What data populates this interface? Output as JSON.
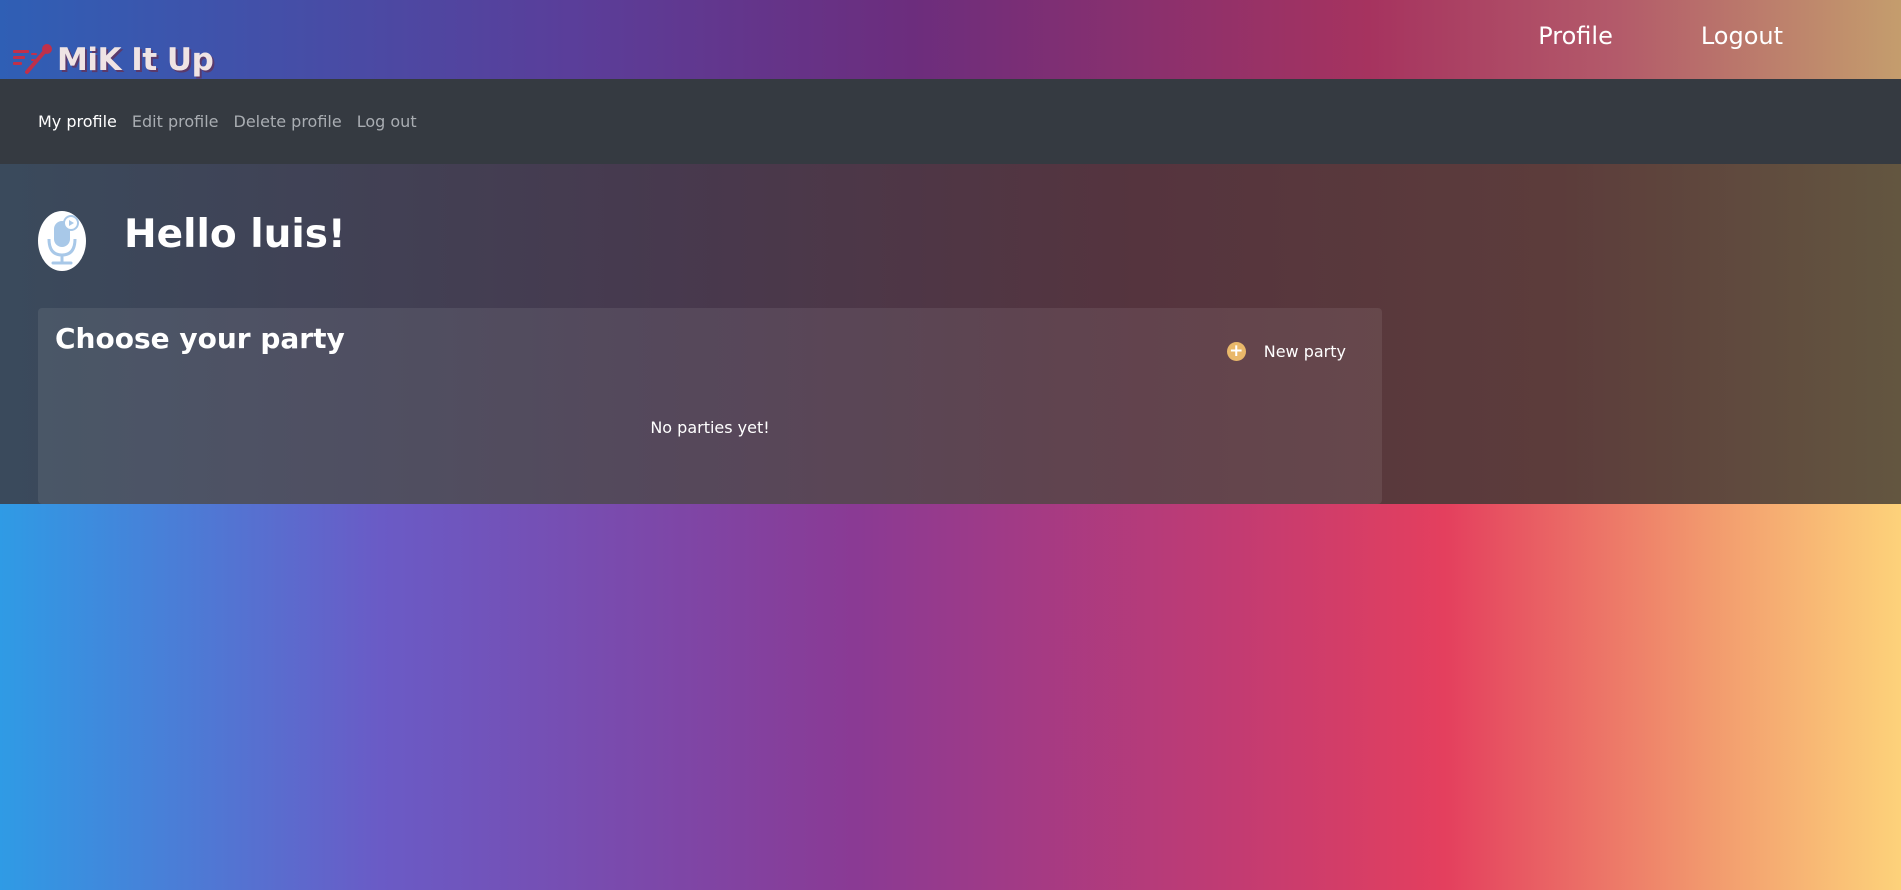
{
  "brand": {
    "name": "MiK It Up",
    "icon": "microphone-logo-icon"
  },
  "topnav": {
    "profile": "Profile",
    "logout": "Logout"
  },
  "subnav": {
    "items": [
      {
        "label": "My profile",
        "active": true
      },
      {
        "label": "Edit profile",
        "active": false
      },
      {
        "label": "Delete profile",
        "active": false
      },
      {
        "label": "Log out",
        "active": false
      }
    ]
  },
  "main": {
    "avatar_icon": "microphone-avatar-icon",
    "greeting": "Hello luis!",
    "card": {
      "title": "Choose your party",
      "new_party_label": "New party",
      "new_party_icon": "plus-circle-icon",
      "empty_message": "No parties yet!"
    }
  },
  "colors": {
    "accent": "#e9b86a",
    "subnav_bg": "#353a41"
  }
}
